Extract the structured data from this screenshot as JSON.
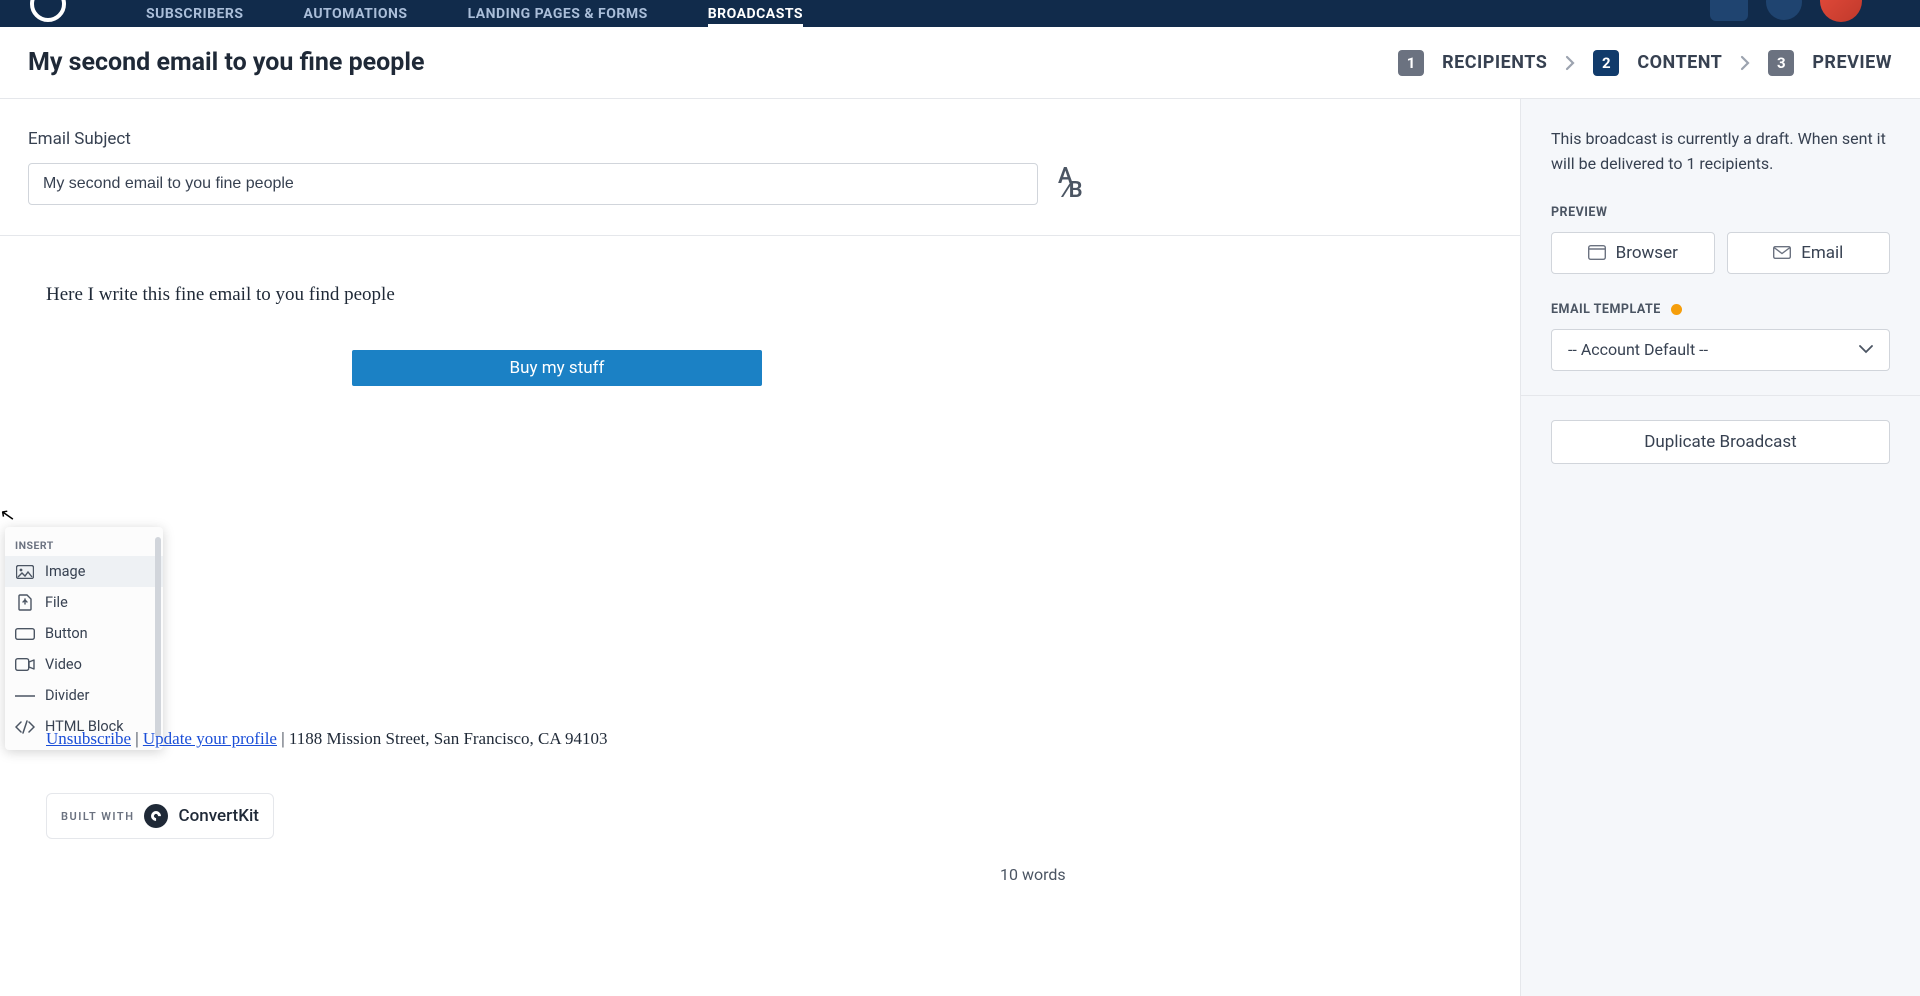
{
  "nav": {
    "items": [
      "SUBSCRIBERS",
      "AUTOMATIONS",
      "LANDING PAGES & FORMS",
      "BROADCASTS"
    ],
    "activeIndex": 3
  },
  "pageTitle": "My second email to you fine people",
  "steps": [
    {
      "num": "1",
      "label": "RECIPIENTS"
    },
    {
      "num": "2",
      "label": "CONTENT"
    },
    {
      "num": "3",
      "label": "PREVIEW"
    }
  ],
  "activeStep": 1,
  "subject": {
    "label": "Email Subject",
    "value": "My second email to you fine people",
    "ab_a": "A",
    "ab_b": "∕B"
  },
  "body": {
    "text": "Here I write this fine email to you find people",
    "buttonLabel": "Buy my stuff"
  },
  "insertMenu": {
    "header": "INSERT",
    "items": [
      {
        "icon": "image",
        "label": "Image",
        "hover": true
      },
      {
        "icon": "file",
        "label": "File"
      },
      {
        "icon": "button",
        "label": "Button"
      },
      {
        "icon": "video",
        "label": "Video"
      },
      {
        "icon": "divider",
        "label": "Divider"
      },
      {
        "icon": "html",
        "label": "HTML Block"
      }
    ]
  },
  "footer": {
    "unsubscribe": "Unsubscribe",
    "sep1": " | ",
    "update": "Update your profile",
    "sep2": " | ",
    "address": "1188 Mission Street, San Francisco, CA 94103",
    "builtWith": "BUILT WITH",
    "brand": "ConvertKit"
  },
  "wordCount": "10 words",
  "sidebar": {
    "helper": "This broadcast is currently a draft. When sent it will be delivered to 1 recipients.",
    "previewLabel": "PREVIEW",
    "browserBtn": "Browser",
    "emailBtn": "Email",
    "templateLabel": "EMAIL TEMPLATE",
    "templateValue": "-- Account Default --",
    "duplicateBtn": "Duplicate Broadcast"
  }
}
